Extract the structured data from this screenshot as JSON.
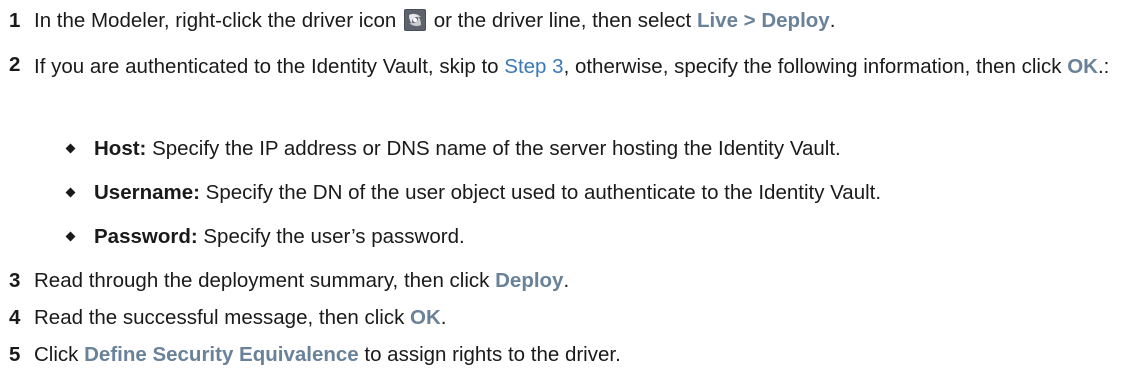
{
  "steps": [
    {
      "number": "1",
      "before_icon": "In the Modeler, right-click the driver icon",
      "icon": "driver-icon",
      "after_icon": " or the driver line, then select ",
      "ui_action": "Live > Deploy",
      "end": "."
    },
    {
      "number": "2",
      "intro": "If you are authenticated to the Identity Vault, skip to ",
      "link": "Step 3",
      "middle": ", otherwise, specify the following information, then click ",
      "ui_action": "OK",
      "end": ".:"
    },
    {
      "number": "3",
      "intro": "Read through the deployment summary, then click ",
      "ui_action": "Deploy",
      "end": "."
    },
    {
      "number": "4",
      "intro": "Read the successful message, then click ",
      "ui_action": "OK",
      "end": "."
    },
    {
      "number": "5",
      "intro": "Click ",
      "ui_action": "Define Security Equivalence",
      "end": " to assign rights to the driver."
    }
  ],
  "bullets": [
    {
      "term": "Host:",
      "text": " Specify the IP address or DNS name of the server hosting the Identity Vault."
    },
    {
      "term": "Username:",
      "text": " Specify the DN of the user object used to authenticate to the Identity Vault."
    },
    {
      "term": "Password:",
      "text": " Specify the user’s password."
    }
  ]
}
